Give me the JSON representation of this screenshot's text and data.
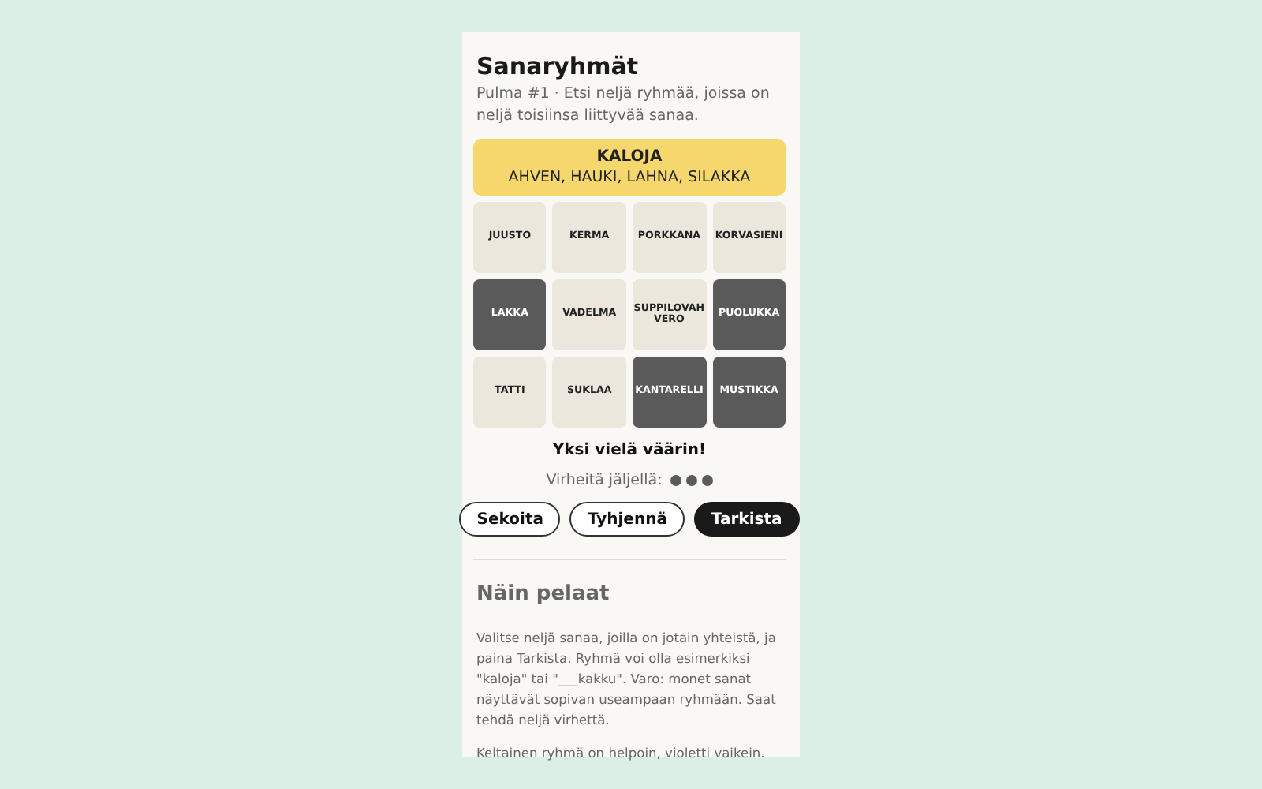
{
  "title": "Sanaryhmät",
  "subtitle": "Pulma #1 · Etsi neljä ryhmää, joissa on neljä toisiinsa liittyvää sanaa.",
  "solved_groups": [
    {
      "name": "KALOJA",
      "words": "AHVEN, HAUKI, LAHNA, SILAKKA",
      "color": "#f5d76e"
    }
  ],
  "tiles": [
    {
      "label": "JUUSTO",
      "selected": false
    },
    {
      "label": "KERMA",
      "selected": false
    },
    {
      "label": "PORKKANA",
      "selected": false
    },
    {
      "label": "KORVASIENI",
      "selected": false
    },
    {
      "label": "LAKKA",
      "selected": true
    },
    {
      "label": "VADELMA",
      "selected": false
    },
    {
      "label": "SUPPILOVAH VERO",
      "selected": false
    },
    {
      "label": "PUOLUKKA",
      "selected": true
    },
    {
      "label": "TATTI",
      "selected": false
    },
    {
      "label": "SUKLAA",
      "selected": false
    },
    {
      "label": "KANTARELLI",
      "selected": true
    },
    {
      "label": "MUSTIKKA",
      "selected": true
    }
  ],
  "message": "Yksi vielä väärin!",
  "mistakes": {
    "label": "Virheitä jäljellä:",
    "dots": [
      {
        "used": false
      },
      {
        "used": false
      },
      {
        "used": false
      }
    ]
  },
  "buttons": [
    {
      "label": "Sekoita",
      "kind": "outline"
    },
    {
      "label": "Tyhjennä",
      "kind": "outline"
    },
    {
      "label": "Tarkista",
      "kind": "primary"
    }
  ],
  "help": {
    "heading": "Näin pelaat",
    "paragraphs": [
      "Valitse neljä sanaa, joilla on jotain yhteistä, ja paina Tarkista. Ryhmä voi olla esimerkiksi \"kaloja\" tai \"___kakku\". Varo: monet sanat näyttävät sopivan useampaan ryhmään. Saat tehdä neljä virhettä.",
      "Keltainen ryhmä on helpoin, violetti vaikein."
    ]
  }
}
